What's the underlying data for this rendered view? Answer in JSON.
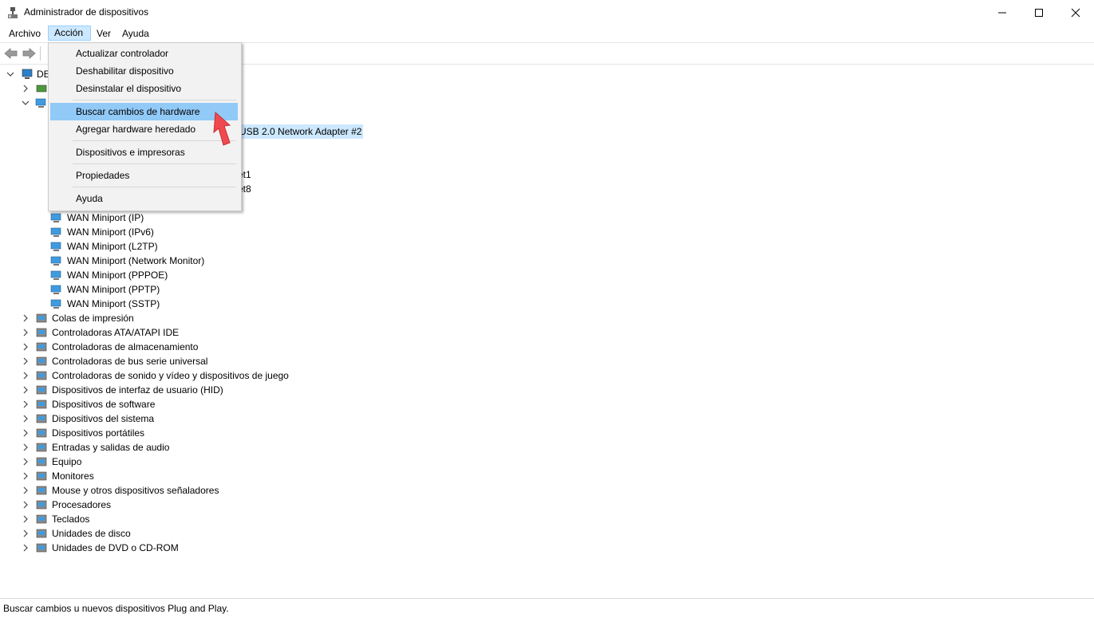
{
  "window": {
    "title": "Administrador de dispositivos"
  },
  "menu": {
    "items": [
      "Archivo",
      "Acción",
      "Ver",
      "Ayuda"
    ],
    "active": "Acción"
  },
  "action_menu": {
    "items": [
      "Actualizar controlador",
      "Deshabilitar dispositivo",
      "Desinstalar el dispositivo",
      "Buscar cambios de hardware",
      "Agregar hardware heredado",
      "Dispositivos e impresoras",
      "Propiedades",
      "Ayuda"
    ],
    "highlighted": "Buscar cambios de hardware"
  },
  "tree": {
    "root_partial": "DE",
    "partial_visible": [
      "USB 2.0 Network Adapter #2",
      "et1",
      "et8"
    ],
    "network_children": [
      "WAN Miniport (IP)",
      "WAN Miniport (IPv6)",
      "WAN Miniport (L2TP)",
      "WAN Miniport (Network Monitor)",
      "WAN Miniport (PPPOE)",
      "WAN Miniport (PPTP)",
      "WAN Miniport (SSTP)"
    ],
    "categories": [
      "Colas de impresión",
      "Controladoras ATA/ATAPI IDE",
      "Controladoras de almacenamiento",
      "Controladoras de bus serie universal",
      "Controladoras de sonido y vídeo y dispositivos de juego",
      "Dispositivos de interfaz de usuario (HID)",
      "Dispositivos de software",
      "Dispositivos del sistema",
      "Dispositivos portátiles",
      "Entradas y salidas de audio",
      "Equipo",
      "Monitores",
      "Mouse y otros dispositivos señaladores",
      "Procesadores",
      "Teclados",
      "Unidades de disco",
      "Unidades de DVD o CD-ROM"
    ]
  },
  "status": {
    "text": "Buscar cambios u nuevos dispositivos Plug and Play."
  },
  "colors": {
    "selection": "#cce8ff",
    "menu_highlight": "#91c9f7",
    "arrow": "#f04a4f"
  }
}
